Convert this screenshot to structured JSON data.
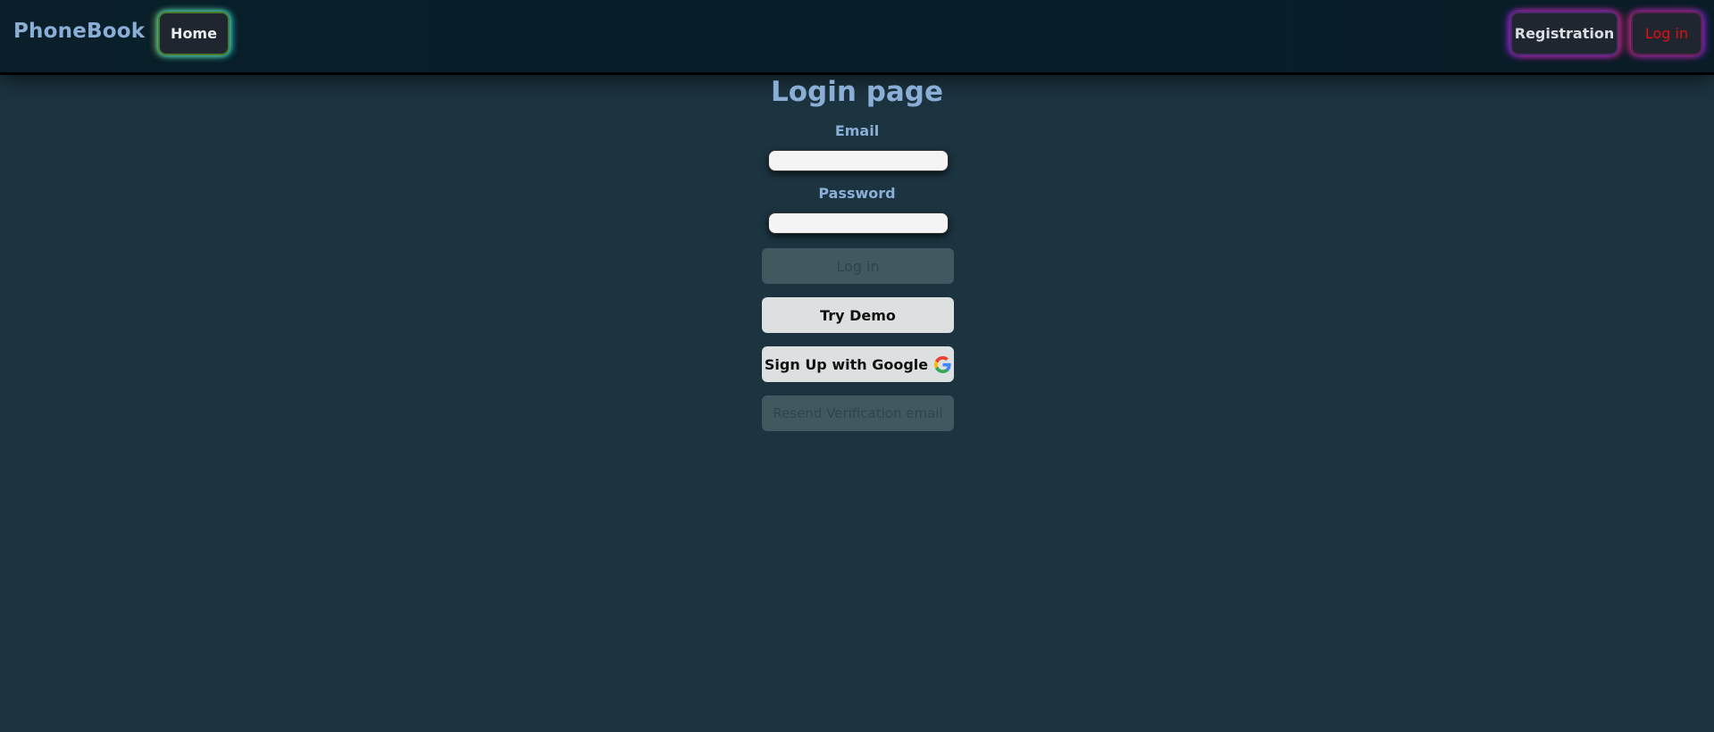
{
  "header": {
    "brand": "PhoneBook",
    "home_label": "Home",
    "registration_label": "Registration",
    "login_label": "Log in"
  },
  "form": {
    "title": "Login page",
    "email_label": "Email",
    "email_value": "",
    "password_label": "Password",
    "password_value": "",
    "login_button": "Log in",
    "demo_button": "Try Demo",
    "google_button": "Sign Up with Google",
    "resend_button": "Resend Verification email"
  },
  "colors": {
    "background": "#1c3440",
    "header": "#051e2a",
    "accent_text": "#8aaed6",
    "nav_login_text": "#e01010"
  },
  "icons": {
    "google": "google-g-icon"
  }
}
